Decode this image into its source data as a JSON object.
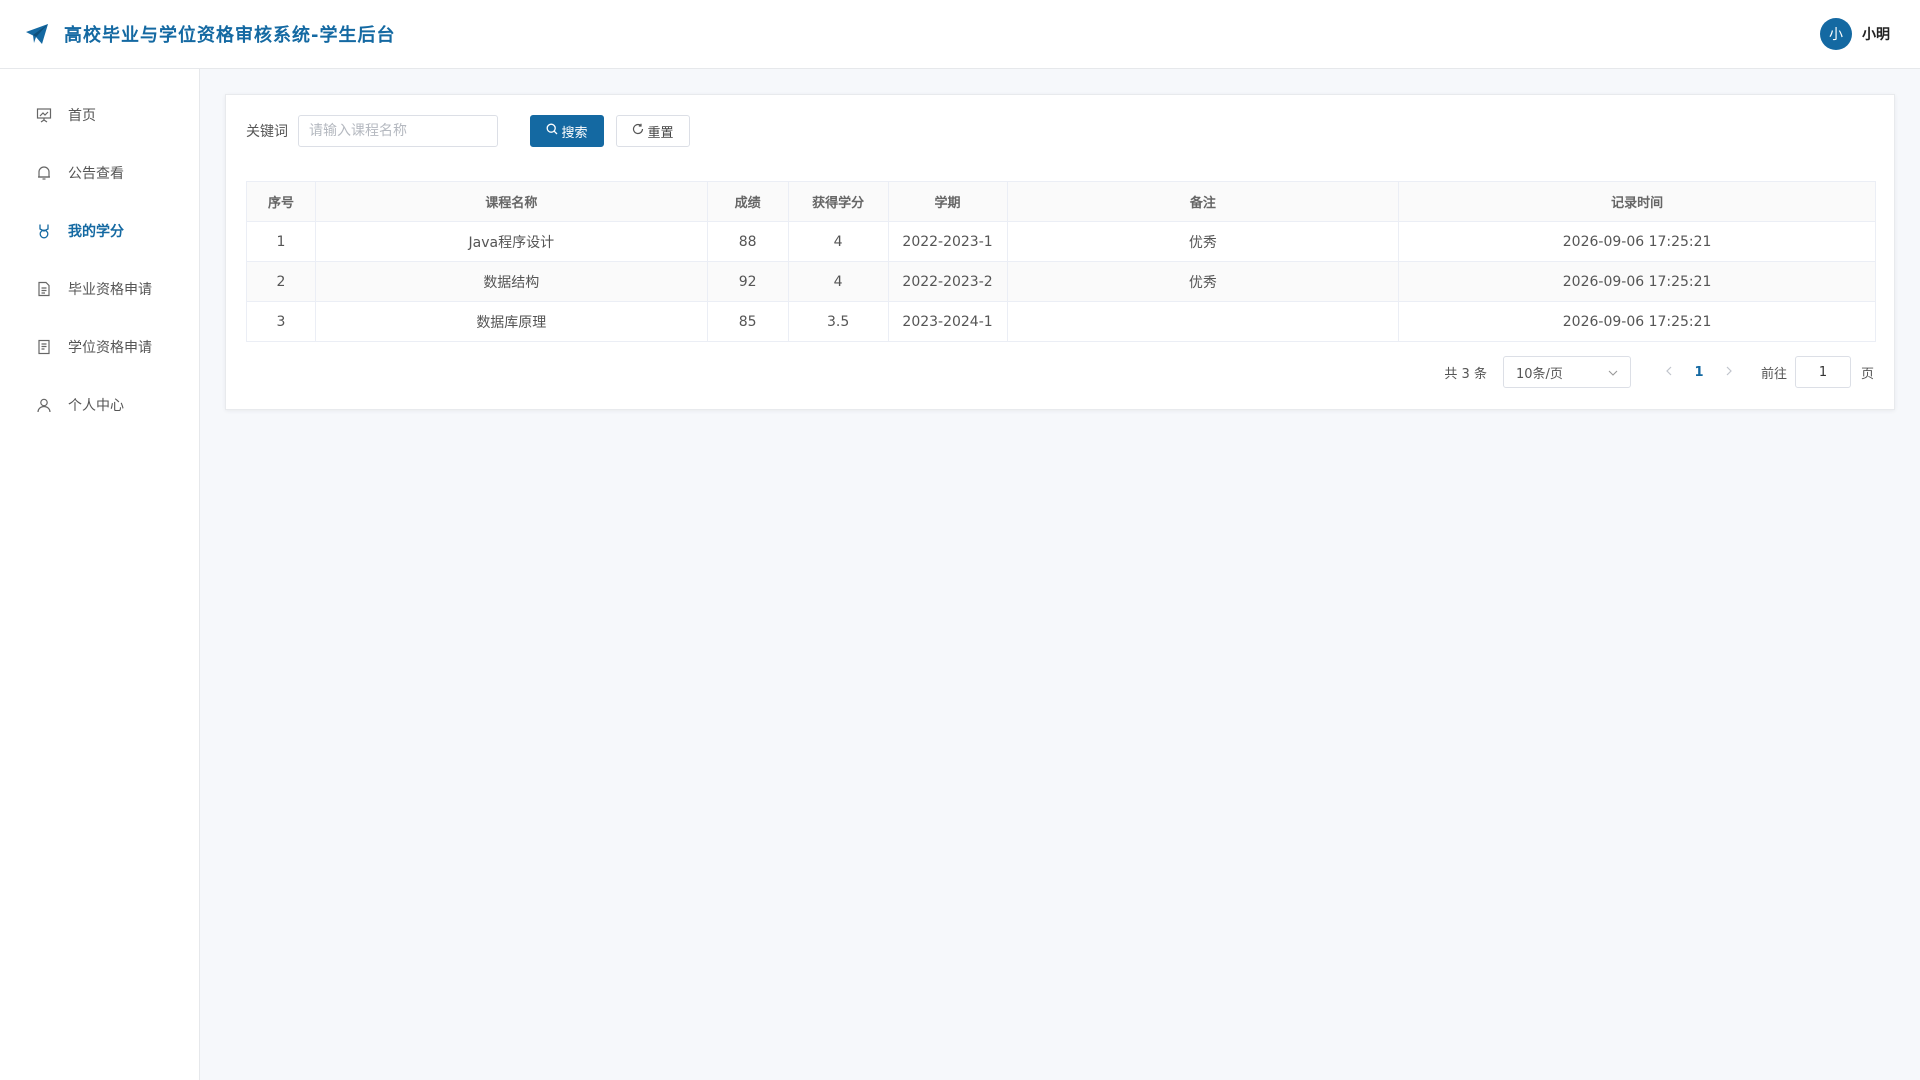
{
  "header": {
    "title": "高校毕业与学位资格审核系统-学生后台",
    "logo_icon": "paper-plane-icon",
    "avatar_initial": "小",
    "user_name": "小明",
    "accent_color": "#1469a2"
  },
  "sidebar": {
    "items": [
      {
        "label": "首页",
        "icon": "presentation-icon",
        "active": false
      },
      {
        "label": "公告查看",
        "icon": "bell-icon",
        "active": false
      },
      {
        "label": "我的学分",
        "icon": "medal-icon",
        "active": true
      },
      {
        "label": "毕业资格申请",
        "icon": "document-icon",
        "active": false
      },
      {
        "label": "学位资格申请",
        "icon": "file-list-icon",
        "active": false
      },
      {
        "label": "个人中心",
        "icon": "user-icon",
        "active": false
      }
    ]
  },
  "search": {
    "label": "关键词",
    "placeholder": "请输入课程名称",
    "value": "",
    "search_button": "搜索",
    "reset_button": "重置"
  },
  "table": {
    "columns": [
      "序号",
      "课程名称",
      "成绩",
      "获得学分",
      "学期",
      "备注",
      "记录时间"
    ],
    "rows": [
      [
        "1",
        "Java程序设计",
        "88",
        "4",
        "2022-2023-1",
        "优秀",
        "2026-09-06 17:25:21"
      ],
      [
        "2",
        "数据结构",
        "92",
        "4",
        "2022-2023-2",
        "优秀",
        "2026-09-06 17:25:21"
      ],
      [
        "3",
        "数据库原理",
        "85",
        "3.5",
        "2023-2024-1",
        "",
        "2026-09-06 17:25:21"
      ]
    ]
  },
  "pagination": {
    "total": "共 3 条",
    "page_size": "10条/页",
    "current_page": "1",
    "goto_label": "前往",
    "goto_value": "1",
    "page_unit": "页"
  }
}
